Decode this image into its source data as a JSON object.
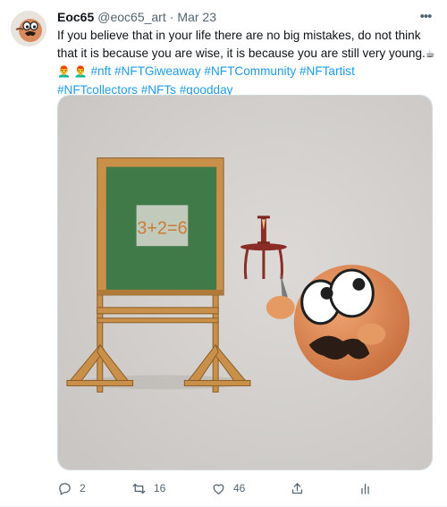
{
  "author": {
    "display_name": "Eoc65",
    "handle": "@eoc65_art",
    "separator": "·",
    "date": "Mar 23"
  },
  "more_label": "•••",
  "text": {
    "body": "If you believe that in your life there are no big mistakes, do not think that it is because you are wise, it is because you are still very young.",
    "emojis": [
      "☕",
      "👨‍🦰",
      "👨‍🦰"
    ],
    "hashtags": [
      "#nft",
      "#NFTGiweaway",
      "#NFTCommunity",
      "#NFTartist",
      "#NFTcollectors",
      "#NFTs",
      "#goodday"
    ]
  },
  "media": {
    "board_text": "3+2=6"
  },
  "actions": {
    "replies": "2",
    "retweets": "16",
    "likes": "46"
  },
  "icons": {
    "more": "more-icon",
    "reply": "reply-icon",
    "retweet": "retweet-icon",
    "like": "heart-icon",
    "share": "share-icon",
    "analytics": "analytics-icon"
  },
  "colors": {
    "link": "#1d9bf0",
    "secondary_text": "#536471",
    "primary_text": "#0f1419"
  }
}
